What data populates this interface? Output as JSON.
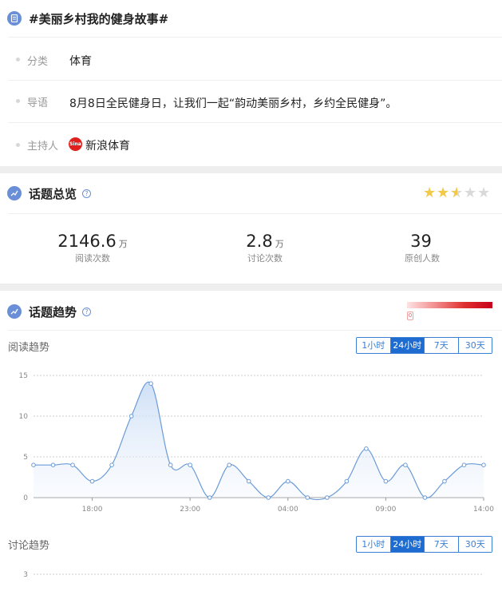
{
  "topic": {
    "title": "#美丽乡村我的健身故事#",
    "category_label": "分类",
    "category_value": "体育",
    "intro_label": "导语",
    "intro_value": "8月8日全民健身日，让我们一起“韵动美丽乡村，乡约全民健身”。",
    "host_label": "主持人",
    "host_value": "新浪体育",
    "host_logo_text": "Sina"
  },
  "overview": {
    "title": "话题总览",
    "help_glyph": "?",
    "rating": 2.5,
    "stats": [
      {
        "value": "2146.6",
        "unit": "万",
        "label": "阅读次数"
      },
      {
        "value": "2.8",
        "unit": "万",
        "label": "讨论次数"
      },
      {
        "value": "39",
        "unit": "",
        "label": "原创人数"
      }
    ]
  },
  "trend": {
    "title": "话题趋势",
    "help_glyph": "?",
    "heat_tag": "0",
    "range_options": [
      "1小时",
      "24小时",
      "7天",
      "30天"
    ],
    "active_range": "24小时",
    "read_trend_title": "阅读趋势",
    "discussion_trend_title": "讨论趋势"
  },
  "colors": {
    "accent": "#1f6cd1",
    "line": "#6a9bd8",
    "star": "#f3c94a",
    "heat_high": "#c8001a"
  },
  "chart_data": [
    {
      "type": "area",
      "title": "阅读趋势",
      "x_ticks": [
        "18:00",
        "23:00",
        "04:00",
        "09:00",
        "14:00"
      ],
      "y_ticks": [
        0,
        5,
        10,
        15
      ],
      "ylim": [
        0,
        15
      ],
      "xlim": [
        0,
        23
      ],
      "grid": true,
      "x": [
        0,
        1,
        2,
        3,
        4,
        5,
        6,
        7,
        8,
        9,
        10,
        11,
        12,
        13,
        14,
        15,
        16,
        17,
        18,
        19,
        20,
        21,
        22,
        23
      ],
      "values": [
        4,
        4,
        4,
        2,
        4,
        10,
        14,
        4,
        4,
        0,
        4,
        2,
        0,
        2,
        0,
        0,
        2,
        6,
        2,
        4,
        0,
        2,
        4,
        4
      ]
    },
    {
      "type": "area",
      "title": "讨论趋势",
      "y_ticks": [
        3
      ],
      "grid": true,
      "values": []
    }
  ]
}
